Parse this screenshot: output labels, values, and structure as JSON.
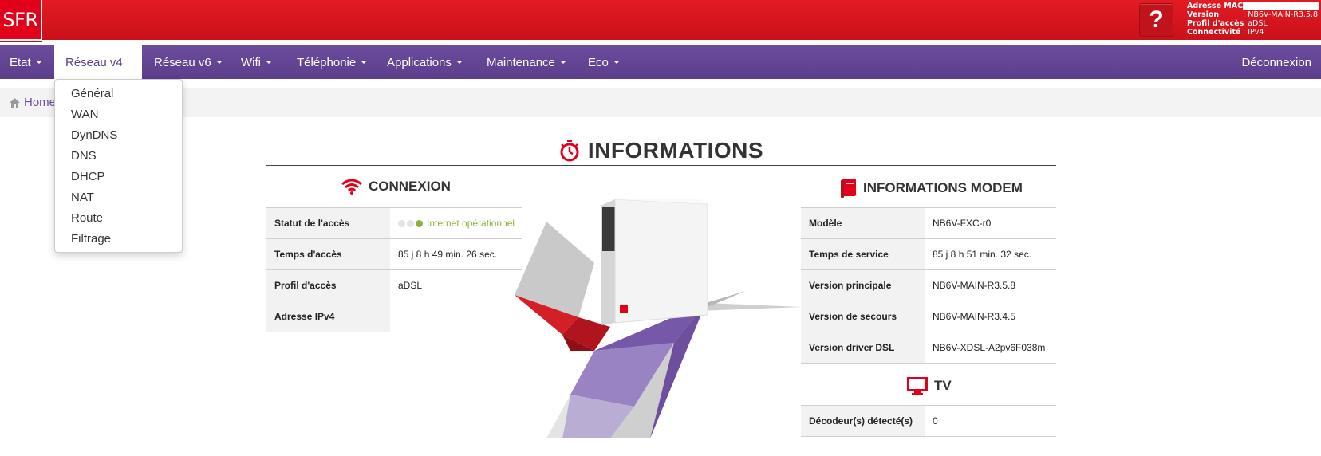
{
  "header": {
    "logo": "SFR",
    "help_label": "?",
    "info": [
      {
        "label": "Adresse MAC",
        "value": ""
      },
      {
        "label": "Version",
        "value": ": NB6V-MAIN-R3.5.8"
      },
      {
        "label": "Profil d'accès",
        "value": ": aDSL"
      },
      {
        "label": "Connectivité",
        "value": ": IPv4"
      }
    ]
  },
  "nav": {
    "items": [
      {
        "label": "Etat"
      },
      {
        "label": "Réseau v4"
      },
      {
        "label": "Réseau v6"
      },
      {
        "label": "Wifi"
      },
      {
        "label": "Téléphonie"
      },
      {
        "label": "Applications"
      },
      {
        "label": "Maintenance"
      },
      {
        "label": "Eco"
      }
    ],
    "logout": "Déconnexion"
  },
  "dropdown": {
    "items": [
      "Général",
      "WAN",
      "DynDNS",
      "DNS",
      "DHCP",
      "NAT",
      "Route",
      "Filtrage"
    ]
  },
  "breadcrumb": {
    "home": "Home"
  },
  "main": {
    "title": "INFORMATIONS",
    "connexion": {
      "title": "CONNEXION",
      "rows": [
        {
          "label": "Statut de l'accès",
          "value": "Internet opérationnel"
        },
        {
          "label": "Temps d'accès",
          "value": "85 j 8 h 49 min. 26 sec."
        },
        {
          "label": "Profil d'accès",
          "value": "aDSL"
        },
        {
          "label": "Adresse IPv4",
          "value": ""
        }
      ]
    },
    "modem": {
      "title": "INFORMATIONS MODEM",
      "rows": [
        {
          "label": "Modèle",
          "value": "NB6V-FXC-r0"
        },
        {
          "label": "Temps de service",
          "value": "85 j 8 h 51 min. 32 sec."
        },
        {
          "label": "Version principale",
          "value": "NB6V-MAIN-R3.5.8"
        },
        {
          "label": "Version de secours",
          "value": "NB6V-MAIN-R3.4.5"
        },
        {
          "label": "Version driver DSL",
          "value": "NB6V-XDSL-A2pv6F038m"
        }
      ]
    },
    "tv": {
      "title": "TV",
      "rows": [
        {
          "label": "Décodeur(s) détecté(s)",
          "value": "0"
        }
      ]
    }
  },
  "colors": {
    "brand_red": "#e2001a",
    "nav_purple": "#5b3e8c",
    "status_green": "#8bb13a"
  },
  "icons": [
    "help-icon",
    "caret-down-icon",
    "home-icon",
    "stopwatch-icon",
    "wifi-icon",
    "book-icon",
    "tv-icon",
    "status-light-icon"
  ]
}
